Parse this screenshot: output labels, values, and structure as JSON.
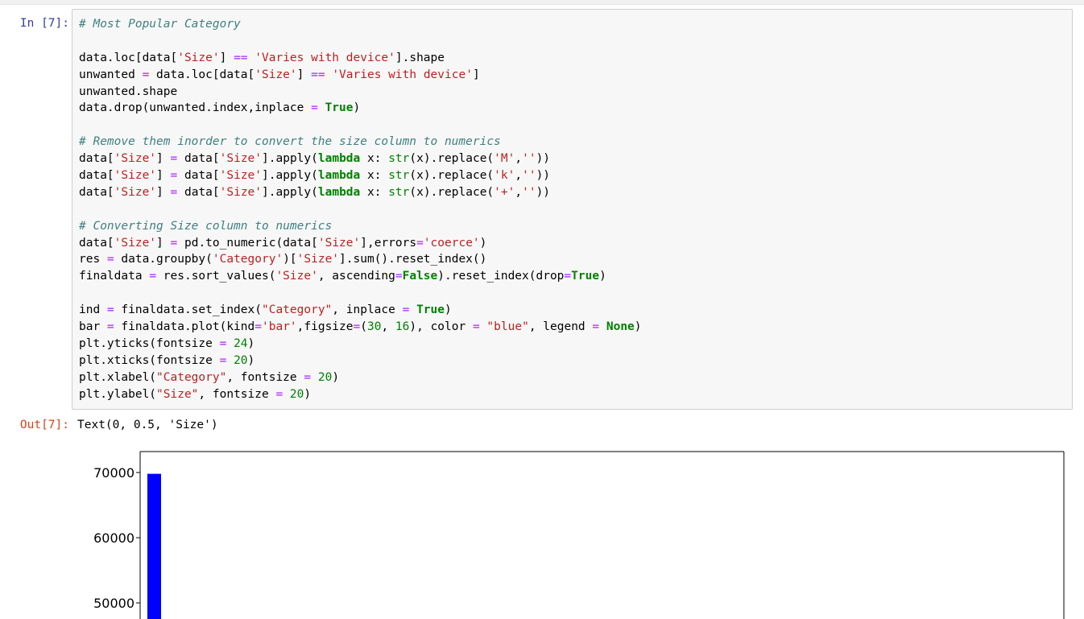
{
  "cell": {
    "in_prompt": "In [7]:",
    "out_prompt": "Out[7]:",
    "code_lines": [
      [
        {
          "t": "# Most Popular Category",
          "c": "cm"
        }
      ],
      [],
      [
        {
          "t": "data.loc[data["
        },
        {
          "t": "'Size'",
          "c": "s1"
        },
        {
          "t": "] "
        },
        {
          "t": "==",
          "c": "o"
        },
        {
          "t": " "
        },
        {
          "t": "'Varies with device'",
          "c": "s1"
        },
        {
          "t": "].shape"
        }
      ],
      [
        {
          "t": "unwanted "
        },
        {
          "t": "=",
          "c": "o"
        },
        {
          "t": " data.loc[data["
        },
        {
          "t": "'Size'",
          "c": "s1"
        },
        {
          "t": "] "
        },
        {
          "t": "==",
          "c": "o"
        },
        {
          "t": " "
        },
        {
          "t": "'Varies with device'",
          "c": "s1"
        },
        {
          "t": "]"
        }
      ],
      [
        {
          "t": "unwanted.shape"
        }
      ],
      [
        {
          "t": "data.drop(unwanted.index,inplace "
        },
        {
          "t": "=",
          "c": "o"
        },
        {
          "t": " "
        },
        {
          "t": "True",
          "c": "kc"
        },
        {
          "t": ")"
        }
      ],
      [],
      [
        {
          "t": "# Remove them inorder to convert the size column to numerics",
          "c": "cm"
        }
      ],
      [
        {
          "t": "data["
        },
        {
          "t": "'Size'",
          "c": "s1"
        },
        {
          "t": "] "
        },
        {
          "t": "=",
          "c": "o"
        },
        {
          "t": " data["
        },
        {
          "t": "'Size'",
          "c": "s1"
        },
        {
          "t": "].apply("
        },
        {
          "t": "lambda",
          "c": "kc"
        },
        {
          "t": " x: "
        },
        {
          "t": "str",
          "c": "nb"
        },
        {
          "t": "(x).replace("
        },
        {
          "t": "'M'",
          "c": "s1"
        },
        {
          "t": ","
        },
        {
          "t": "''",
          "c": "s1"
        },
        {
          "t": "))"
        }
      ],
      [
        {
          "t": "data["
        },
        {
          "t": "'Size'",
          "c": "s1"
        },
        {
          "t": "] "
        },
        {
          "t": "=",
          "c": "o"
        },
        {
          "t": " data["
        },
        {
          "t": "'Size'",
          "c": "s1"
        },
        {
          "t": "].apply("
        },
        {
          "t": "lambda",
          "c": "kc"
        },
        {
          "t": " x: "
        },
        {
          "t": "str",
          "c": "nb"
        },
        {
          "t": "(x).replace("
        },
        {
          "t": "'k'",
          "c": "s1"
        },
        {
          "t": ","
        },
        {
          "t": "''",
          "c": "s1"
        },
        {
          "t": "))"
        }
      ],
      [
        {
          "t": "data["
        },
        {
          "t": "'Size'",
          "c": "s1"
        },
        {
          "t": "] "
        },
        {
          "t": "=",
          "c": "o"
        },
        {
          "t": " data["
        },
        {
          "t": "'Size'",
          "c": "s1"
        },
        {
          "t": "].apply("
        },
        {
          "t": "lambda",
          "c": "kc"
        },
        {
          "t": " x: "
        },
        {
          "t": "str",
          "c": "nb"
        },
        {
          "t": "(x).replace("
        },
        {
          "t": "'+'",
          "c": "s1"
        },
        {
          "t": ","
        },
        {
          "t": "''",
          "c": "s1"
        },
        {
          "t": "))"
        }
      ],
      [],
      [
        {
          "t": "# Converting Size column to numerics",
          "c": "cm"
        }
      ],
      [
        {
          "t": "data["
        },
        {
          "t": "'Size'",
          "c": "s1"
        },
        {
          "t": "] "
        },
        {
          "t": "=",
          "c": "o"
        },
        {
          "t": " pd.to_numeric(data["
        },
        {
          "t": "'Size'",
          "c": "s1"
        },
        {
          "t": "],errors"
        },
        {
          "t": "=",
          "c": "o"
        },
        {
          "t": "'coerce'",
          "c": "s1"
        },
        {
          "t": ")"
        }
      ],
      [
        {
          "t": "res "
        },
        {
          "t": "=",
          "c": "o"
        },
        {
          "t": " data.groupby("
        },
        {
          "t": "'Category'",
          "c": "s1"
        },
        {
          "t": ")["
        },
        {
          "t": "'Size'",
          "c": "s1"
        },
        {
          "t": "].sum().reset_index()"
        }
      ],
      [
        {
          "t": "finaldata "
        },
        {
          "t": "=",
          "c": "o"
        },
        {
          "t": " res.sort_values("
        },
        {
          "t": "'Size'",
          "c": "s1"
        },
        {
          "t": ", ascending"
        },
        {
          "t": "=",
          "c": "o"
        },
        {
          "t": "False",
          "c": "kc"
        },
        {
          "t": ").reset_index(drop"
        },
        {
          "t": "=",
          "c": "o"
        },
        {
          "t": "True",
          "c": "kc"
        },
        {
          "t": ")"
        }
      ],
      [],
      [
        {
          "t": "ind "
        },
        {
          "t": "=",
          "c": "o"
        },
        {
          "t": " finaldata.set_index("
        },
        {
          "t": "\"Category\"",
          "c": "s1"
        },
        {
          "t": ", inplace "
        },
        {
          "t": "=",
          "c": "o"
        },
        {
          "t": " "
        },
        {
          "t": "True",
          "c": "kc"
        },
        {
          "t": ")"
        }
      ],
      [
        {
          "t": "bar "
        },
        {
          "t": "=",
          "c": "o"
        },
        {
          "t": " finaldata.plot(kind"
        },
        {
          "t": "=",
          "c": "o"
        },
        {
          "t": "'bar'",
          "c": "s1"
        },
        {
          "t": ",figsize"
        },
        {
          "t": "=",
          "c": "o"
        },
        {
          "t": "("
        },
        {
          "t": "30",
          "c": "mi"
        },
        {
          "t": ", "
        },
        {
          "t": "16",
          "c": "mi"
        },
        {
          "t": "), color "
        },
        {
          "t": "=",
          "c": "o"
        },
        {
          "t": " "
        },
        {
          "t": "\"blue\"",
          "c": "s1"
        },
        {
          "t": ", legend "
        },
        {
          "t": "=",
          "c": "o"
        },
        {
          "t": " "
        },
        {
          "t": "None",
          "c": "kc"
        },
        {
          "t": ")"
        }
      ],
      [
        {
          "t": "plt.yticks(fontsize "
        },
        {
          "t": "=",
          "c": "o"
        },
        {
          "t": " "
        },
        {
          "t": "24",
          "c": "mi"
        },
        {
          "t": ")"
        }
      ],
      [
        {
          "t": "plt.xticks(fontsize "
        },
        {
          "t": "=",
          "c": "o"
        },
        {
          "t": " "
        },
        {
          "t": "20",
          "c": "mi"
        },
        {
          "t": ")"
        }
      ],
      [
        {
          "t": "plt.xlabel("
        },
        {
          "t": "\"Category\"",
          "c": "s1"
        },
        {
          "t": ", fontsize "
        },
        {
          "t": "=",
          "c": "o"
        },
        {
          "t": " "
        },
        {
          "t": "20",
          "c": "mi"
        },
        {
          "t": ")"
        }
      ],
      [
        {
          "t": "plt.ylabel("
        },
        {
          "t": "\"Size\"",
          "c": "s1"
        },
        {
          "t": ", fontsize "
        },
        {
          "t": "=",
          "c": "o"
        },
        {
          "t": " "
        },
        {
          "t": "20",
          "c": "mi"
        },
        {
          "t": ")"
        }
      ]
    ],
    "output_text": "Text(0, 0.5, 'Size')"
  },
  "colors": {
    "bar": "#0000ff",
    "in_prompt": "#303f9f",
    "out_prompt": "#d84315"
  },
  "chart_data": {
    "type": "bar",
    "values": [
      69800
    ],
    "yticks": [
      50000,
      60000,
      70000
    ],
    "visible_ylim": [
      47500,
      72000
    ],
    "title": "",
    "xlabel": "",
    "ylabel": ""
  }
}
